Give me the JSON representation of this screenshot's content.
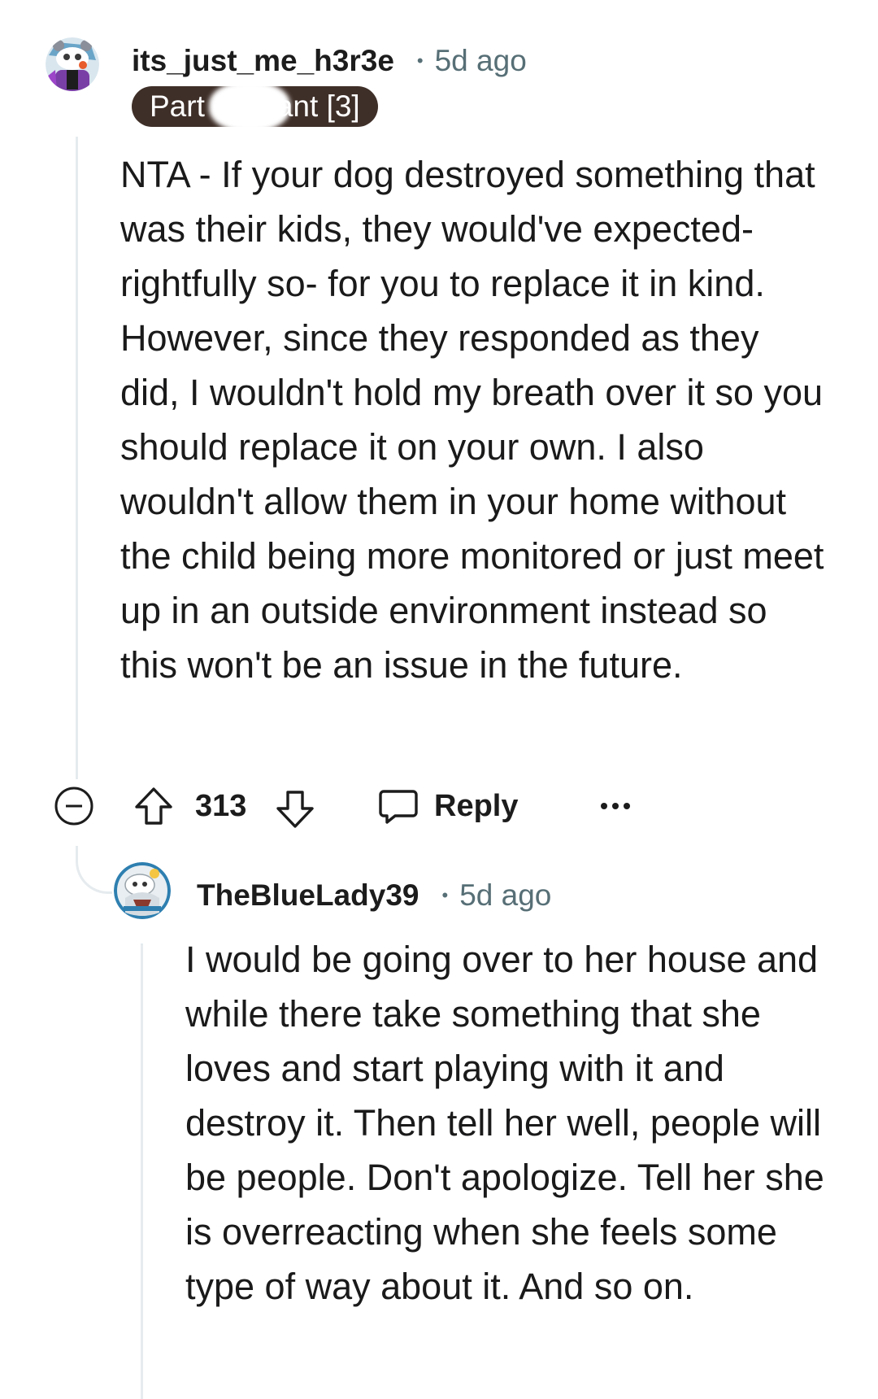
{
  "comments": [
    {
      "avatar_icon": "snoo-avatar-icon",
      "username": "its_just_me_h3r3e",
      "separator": "•",
      "time": "5d ago",
      "flair_visible": "Part",
      "flair_tail": "ant [3]",
      "body": "NTA - If your dog destroyed something that was their kids, they would've expected- rightfully so- for you to replace it in kind. However, since they responded as they did, I wouldn't hold my breath over it so you should replace it on your own. I also wouldn't allow them in your home without the child being more monitored or just meet up in an outside environment instead so this won't be an issue in the future.",
      "actions": {
        "collapse_icon": "collapse-minus-icon",
        "upvote_icon": "upvote-arrow-icon",
        "score": "313",
        "downvote_icon": "downvote-arrow-icon",
        "reply_icon": "speech-bubble-icon",
        "reply_label": "Reply",
        "more_icon": "ellipsis-icon"
      }
    },
    {
      "avatar_icon": "snoo-avatar-icon",
      "username": "TheBlueLady39",
      "separator": "•",
      "time": "5d ago",
      "body": "I would be going over to her house and while there take something that she loves and start playing with it and destroy it. Then tell her well, people will be people. Don't apologize. Tell her she is overreacting when she feels some type of way about it. And so on."
    }
  ],
  "colors": {
    "flair_bg": "#3f2f29",
    "meta_gray": "#576f76",
    "thread_line": "#e5ebee",
    "text": "#1a1a1b"
  }
}
